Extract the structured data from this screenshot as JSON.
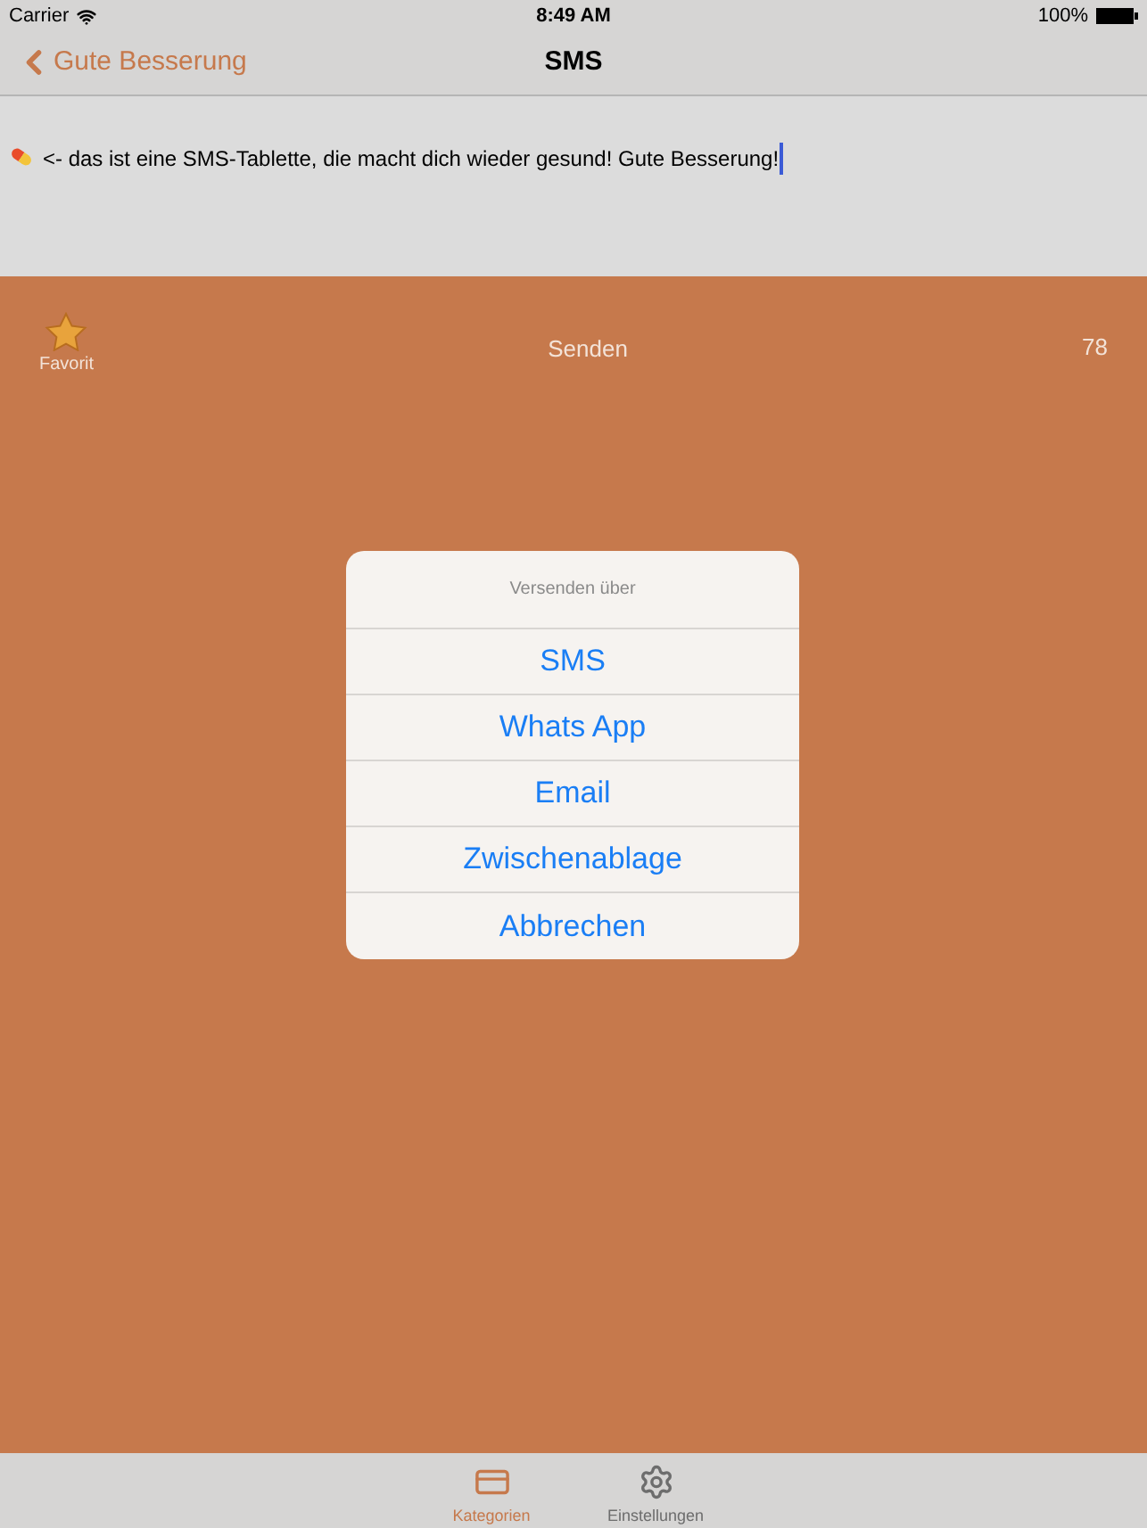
{
  "status_bar": {
    "carrier": "Carrier",
    "time": "8:49 AM",
    "battery": "100%"
  },
  "nav": {
    "back": "Gute Besserung",
    "title": "SMS"
  },
  "message": {
    "text": "<- das ist eine SMS-Tablette, die macht dich wieder gesund! Gute Besserung!"
  },
  "toolbar": {
    "favorite": "Favorit",
    "send": "Senden",
    "count": "78"
  },
  "action_sheet": {
    "title": "Versenden über",
    "options": [
      "SMS",
      "Whats App",
      "Email",
      "Zwischenablage",
      "Abbrechen"
    ]
  },
  "tab_bar": [
    {
      "label": "Kategorien",
      "kind": "card",
      "selected": true
    },
    {
      "label": "Einstellungen",
      "kind": "gear",
      "selected": false
    }
  ]
}
